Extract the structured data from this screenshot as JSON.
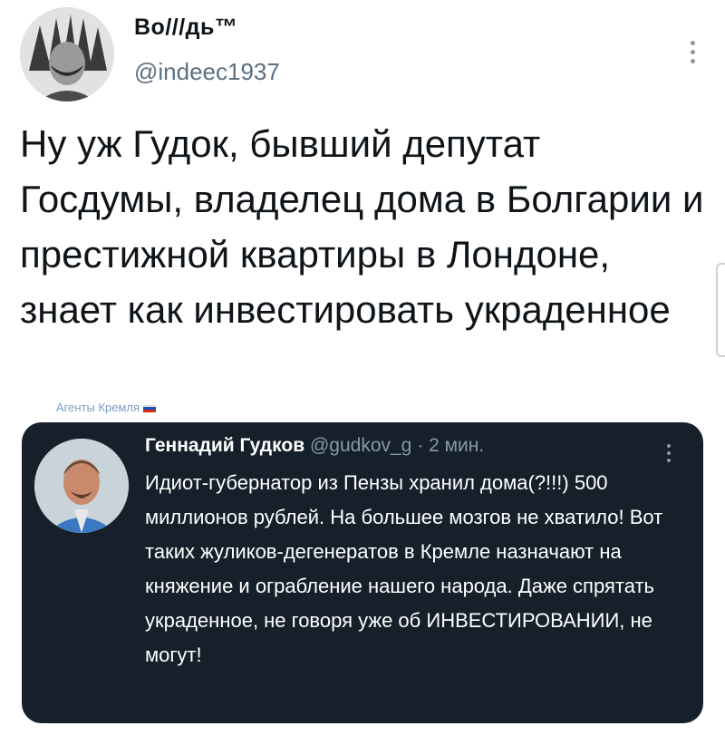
{
  "tweet": {
    "author_name": "Bo///дь™",
    "author_handle": "@indeec1937",
    "text": "Ну уж Гудок, бывший депутат Госдумы, владелец дома в Болгарии и престижной квартиры в Лондоне, знает как инвестировать украденное",
    "more_icon": "more-vertical-icon"
  },
  "watermark": {
    "text": "Агенты Кремля",
    "flag_colors": [
      "#ffffff",
      "#1d4fb8",
      "#d52b1e"
    ]
  },
  "quoted_tweet": {
    "author_name": "Геннадий Гудков",
    "author_handle": "@gudkov_g",
    "separator": "·",
    "time": "2 мин.",
    "text": "Идиот-губернатор из Пензы хранил дома(?!!!) 500 миллионов рублей. На большее мозгов не хватило! Вот таких жуликов-дегенератов в Кремле назначают на княжение и ограбление нашего народа. Даже спрятать украденное, не говоря уже об ИНВЕСТИРОВАНИИ, не могут!",
    "background": "#15202b"
  }
}
